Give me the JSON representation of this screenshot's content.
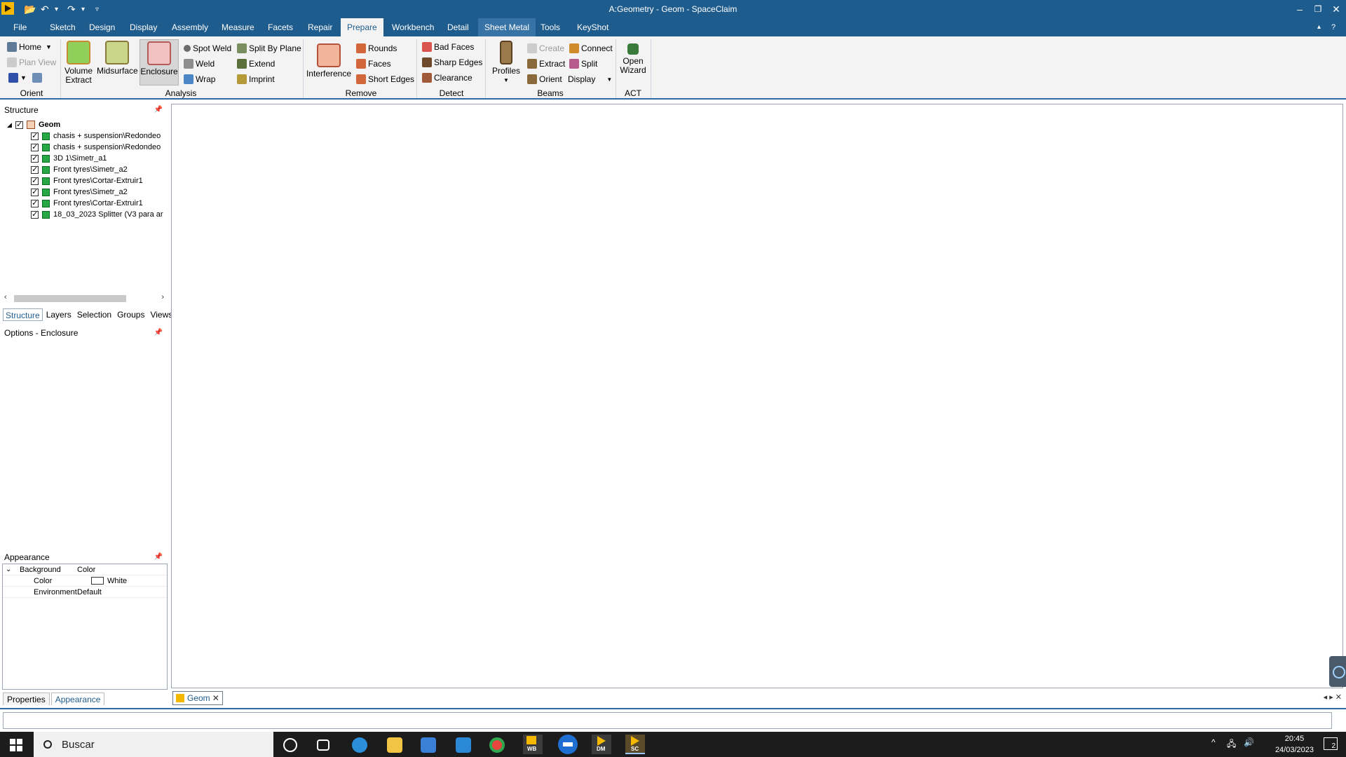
{
  "window": {
    "title": "A:Geometry - Geom - SpaceClaim",
    "controls": {
      "minimize": "–",
      "restore": "❐",
      "close": "✕"
    }
  },
  "menu_tabs": [
    {
      "label": "File"
    },
    {
      "label": "Sketch"
    },
    {
      "label": "Design"
    },
    {
      "label": "Display"
    },
    {
      "label": "Assembly"
    },
    {
      "label": "Measure"
    },
    {
      "label": "Facets"
    },
    {
      "label": "Repair"
    },
    {
      "label": "Prepare"
    },
    {
      "label": "Workbench"
    },
    {
      "label": "Detail"
    },
    {
      "label": "Sheet Metal"
    },
    {
      "label": "Tools"
    },
    {
      "label": "KeyShot"
    }
  ],
  "ribbon": {
    "orient": {
      "home": "Home",
      "plan_view": "Plan View",
      "group": "Orient"
    },
    "analysis": {
      "volume_extract": "Volume\nExtract",
      "midsurface": "Midsurface",
      "enclosure": "Enclosure",
      "spot_weld": "Spot Weld",
      "weld": "Weld",
      "wrap": "Wrap",
      "split_by_plane": "Split By Plane",
      "extend": "Extend",
      "imprint": "Imprint",
      "group": "Analysis"
    },
    "remove": {
      "interference": "Interference",
      "rounds": "Rounds",
      "faces": "Faces",
      "short_edges": "Short Edges",
      "group": "Remove"
    },
    "detect": {
      "bad_faces": "Bad Faces",
      "sharp_edges": "Sharp Edges",
      "clearance": "Clearance",
      "group": "Detect"
    },
    "beams": {
      "profiles": "Profiles",
      "create": "Create",
      "extract": "Extract",
      "orient": "Orient",
      "connect": "Connect",
      "split": "Split",
      "display": "Display",
      "group": "Beams"
    },
    "act": {
      "open_wizard": "Open\nWizard",
      "group": "ACT"
    }
  },
  "structure": {
    "title": "Structure",
    "root": "Geom",
    "items": [
      "chasis + suspension\\Redondeo",
      "chasis + suspension\\Redondeo",
      "3D 1\\Simetr_a1",
      "Front tyres\\Simetr_a2",
      "Front tyres\\Cortar-Extruir1",
      "Front tyres\\Simetr_a2",
      "Front tyres\\Cortar-Extruir1",
      "18_03_2023 Splitter (V3 para ar"
    ]
  },
  "left_tabs": [
    "Structure",
    "Layers",
    "Selection",
    "Groups",
    "Views"
  ],
  "options": {
    "title": "Options - Enclosure"
  },
  "appearance": {
    "title": "Appearance",
    "rows": [
      {
        "name": "Background",
        "value": "Color"
      },
      {
        "name": "Color",
        "value": "White"
      },
      {
        "name": "Environment",
        "value": "Default"
      }
    ]
  },
  "bottom_tabs": [
    "Properties",
    "Appearance"
  ],
  "doc_tab": {
    "label": "Geom"
  },
  "taskbar": {
    "search_placeholder": "Buscar",
    "app_labels": {
      "wb": "WB",
      "dm": "DM",
      "sc": "SC"
    },
    "time": "20:45",
    "date": "24/03/2023",
    "notifications": "2"
  },
  "colors": {
    "title_bar": "#1f5c8e",
    "ribbon": "#f3f3f3",
    "accent": "#2c6aa0"
  }
}
